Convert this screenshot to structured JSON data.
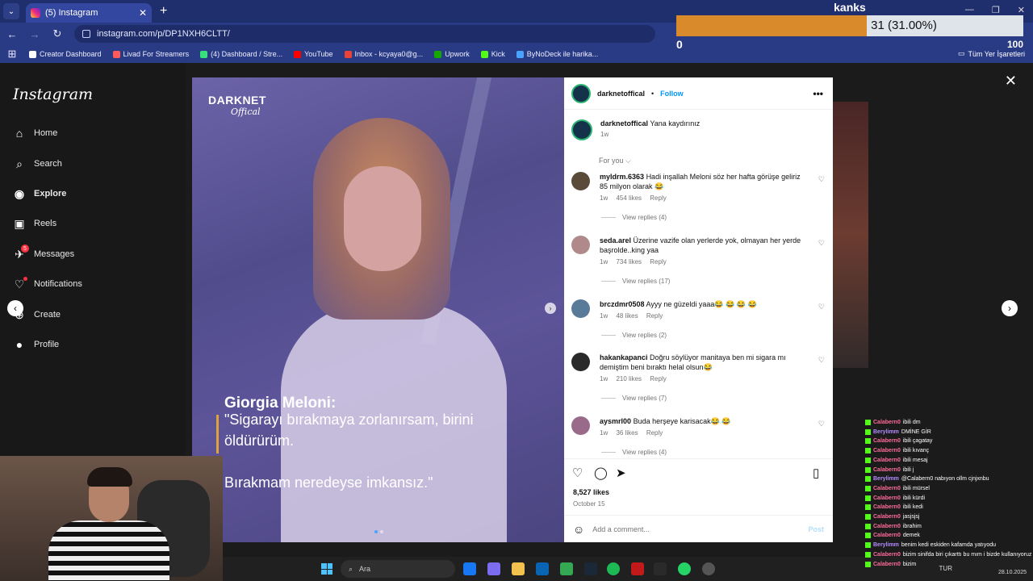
{
  "browser": {
    "tab_title": "(5) Instagram",
    "url": "instagram.com/p/DP1NXH6CLTT/",
    "bookmarks": [
      {
        "label": "Creator Dashboard",
        "color": "#ffffff"
      },
      {
        "label": "Livad For Streamers",
        "color": "#ff5a5a"
      },
      {
        "label": "(4) Dashboard / Stre...",
        "color": "#38e07b"
      },
      {
        "label": "YouTube",
        "color": "#ff0000"
      },
      {
        "label": "Inbox - kcyaya0@g...",
        "color": "#ea4335"
      },
      {
        "label": "Upwork",
        "color": "#14a800"
      },
      {
        "label": "Kick",
        "color": "#53fc18"
      },
      {
        "label": "ByNoDeck ile harika...",
        "color": "#4aa3ff"
      }
    ],
    "bookmarks_right": "Tüm Yer İşaretleri"
  },
  "poll": {
    "title": "kanks",
    "text": "31 (31.00%)",
    "percent": 31,
    "min": "0",
    "max": "100"
  },
  "sidebar": {
    "logo": "Instagram",
    "items": [
      {
        "label": "Home",
        "icon": "home-icon",
        "glyph": "⌂"
      },
      {
        "label": "Search",
        "icon": "search-icon",
        "glyph": "⌕"
      },
      {
        "label": "Explore",
        "icon": "explore-icon",
        "glyph": "◉"
      },
      {
        "label": "Reels",
        "icon": "reels-icon",
        "glyph": "▣"
      },
      {
        "label": "Messages",
        "icon": "messages-icon",
        "glyph": "✈",
        "badge": "5"
      },
      {
        "label": "Notifications",
        "icon": "heart-icon",
        "glyph": "♡"
      },
      {
        "label": "Create",
        "icon": "create-icon",
        "glyph": "⊕"
      },
      {
        "label": "Profile",
        "icon": "profile-avatar",
        "glyph": "●"
      }
    ]
  },
  "post": {
    "brand": "DARKNET",
    "brand_sub": "Offical",
    "quote_name": "Giorgia Meloni:",
    "quote_line1": "\"Sigarayı bırakmaya zorlanırsam, birini",
    "quote_line2": "öldürürüm.",
    "quote_line3": "Bırakmam neredeyse imkansız.\""
  },
  "panel": {
    "username": "darknetoffical",
    "follow": "Follow",
    "separator": "•",
    "caption_user": "darknetoffical",
    "caption_text": "Yana kaydırınız",
    "caption_time": "1w",
    "for_you": "For you ⌵",
    "comments": [
      {
        "user": "myldrm.6363",
        "text": "Hadi inşallah Meloni söz her hafta görüşe geliriz 85 milyon olarak 😂",
        "time": "1w",
        "likes": "454 likes",
        "reply": "Reply",
        "replies": "View replies (4)"
      },
      {
        "user": "seda.arel",
        "text": "Üzerine vazife olan yerlerde yok, olmayan her yerde başrolde..king yaa",
        "time": "1w",
        "likes": "734 likes",
        "reply": "Reply",
        "replies": "View replies (17)"
      },
      {
        "user": "brczdmr0508",
        "text": "Ayyy ne güzeldi yaaa😂 😂 😂 😂",
        "time": "1w",
        "likes": "48 likes",
        "reply": "Reply",
        "replies": "View replies (2)"
      },
      {
        "user": "hakankapanci",
        "text": "Doğru söylüyor manitaya ben mi sigara mı demiştim beni bıraktı helal olsun😂",
        "time": "1w",
        "likes": "210 likes",
        "reply": "Reply",
        "replies": "View replies (7)"
      },
      {
        "user": "aysmrl00",
        "text": "Buda herşeye karisacak😂 😂",
        "time": "1w",
        "likes": "36 likes",
        "reply": "Reply",
        "replies": "View replies (4)"
      }
    ],
    "likes": "8,527 likes",
    "date": "October 15",
    "comment_placeholder": "Add a comment...",
    "post_btn": "Post"
  },
  "taskbar": {
    "search_placeholder": "Ara",
    "lang": "TUR",
    "date": "28.10.2025"
  },
  "chat": [
    {
      "name": "Calabern0",
      "msg": "ibili dm",
      "color": "#ff6b9a"
    },
    {
      "name": "Berylimm",
      "msg": "DMİNE GİR",
      "color": "#b48cff"
    },
    {
      "name": "Calabern0",
      "msg": "ibili çagatay",
      "color": "#ff6b9a"
    },
    {
      "name": "Calabern0",
      "msg": "ibili kıvanç",
      "color": "#ff6b9a"
    },
    {
      "name": "Calabern0",
      "msg": "ibili mesaj",
      "color": "#ff6b9a"
    },
    {
      "name": "Calabern0",
      "msg": "ibili j",
      "color": "#ff6b9a"
    },
    {
      "name": "Berylimm",
      "msg": "@Calabern0 nabıyon ollm cjnjxnbu",
      "color": "#b48cff"
    },
    {
      "name": "Calabern0",
      "msg": "ibili mürsel",
      "color": "#ff6b9a"
    },
    {
      "name": "Calabern0",
      "msg": "ibili kürdi",
      "color": "#ff6b9a"
    },
    {
      "name": "Calabern0",
      "msg": "ibili kedi",
      "color": "#ff6b9a"
    },
    {
      "name": "Calabern0",
      "msg": "jasjsjsj",
      "color": "#ff6b9a"
    },
    {
      "name": "Calabern0",
      "msg": "ibrahim",
      "color": "#ff6b9a"
    },
    {
      "name": "Calabern0",
      "msg": "demek",
      "color": "#ff6b9a"
    },
    {
      "name": "Berylimm",
      "msg": "benim kedi eskiden kafamda yatıyodu",
      "color": "#b48cff"
    },
    {
      "name": "Calabern0",
      "msg": "bizim sinifda biri çıkarttı bu mım i bizde kullanıyoruz",
      "color": "#ff6b9a"
    },
    {
      "name": "Calabern0",
      "msg": "bizim",
      "color": "#ff6b9a"
    }
  ]
}
